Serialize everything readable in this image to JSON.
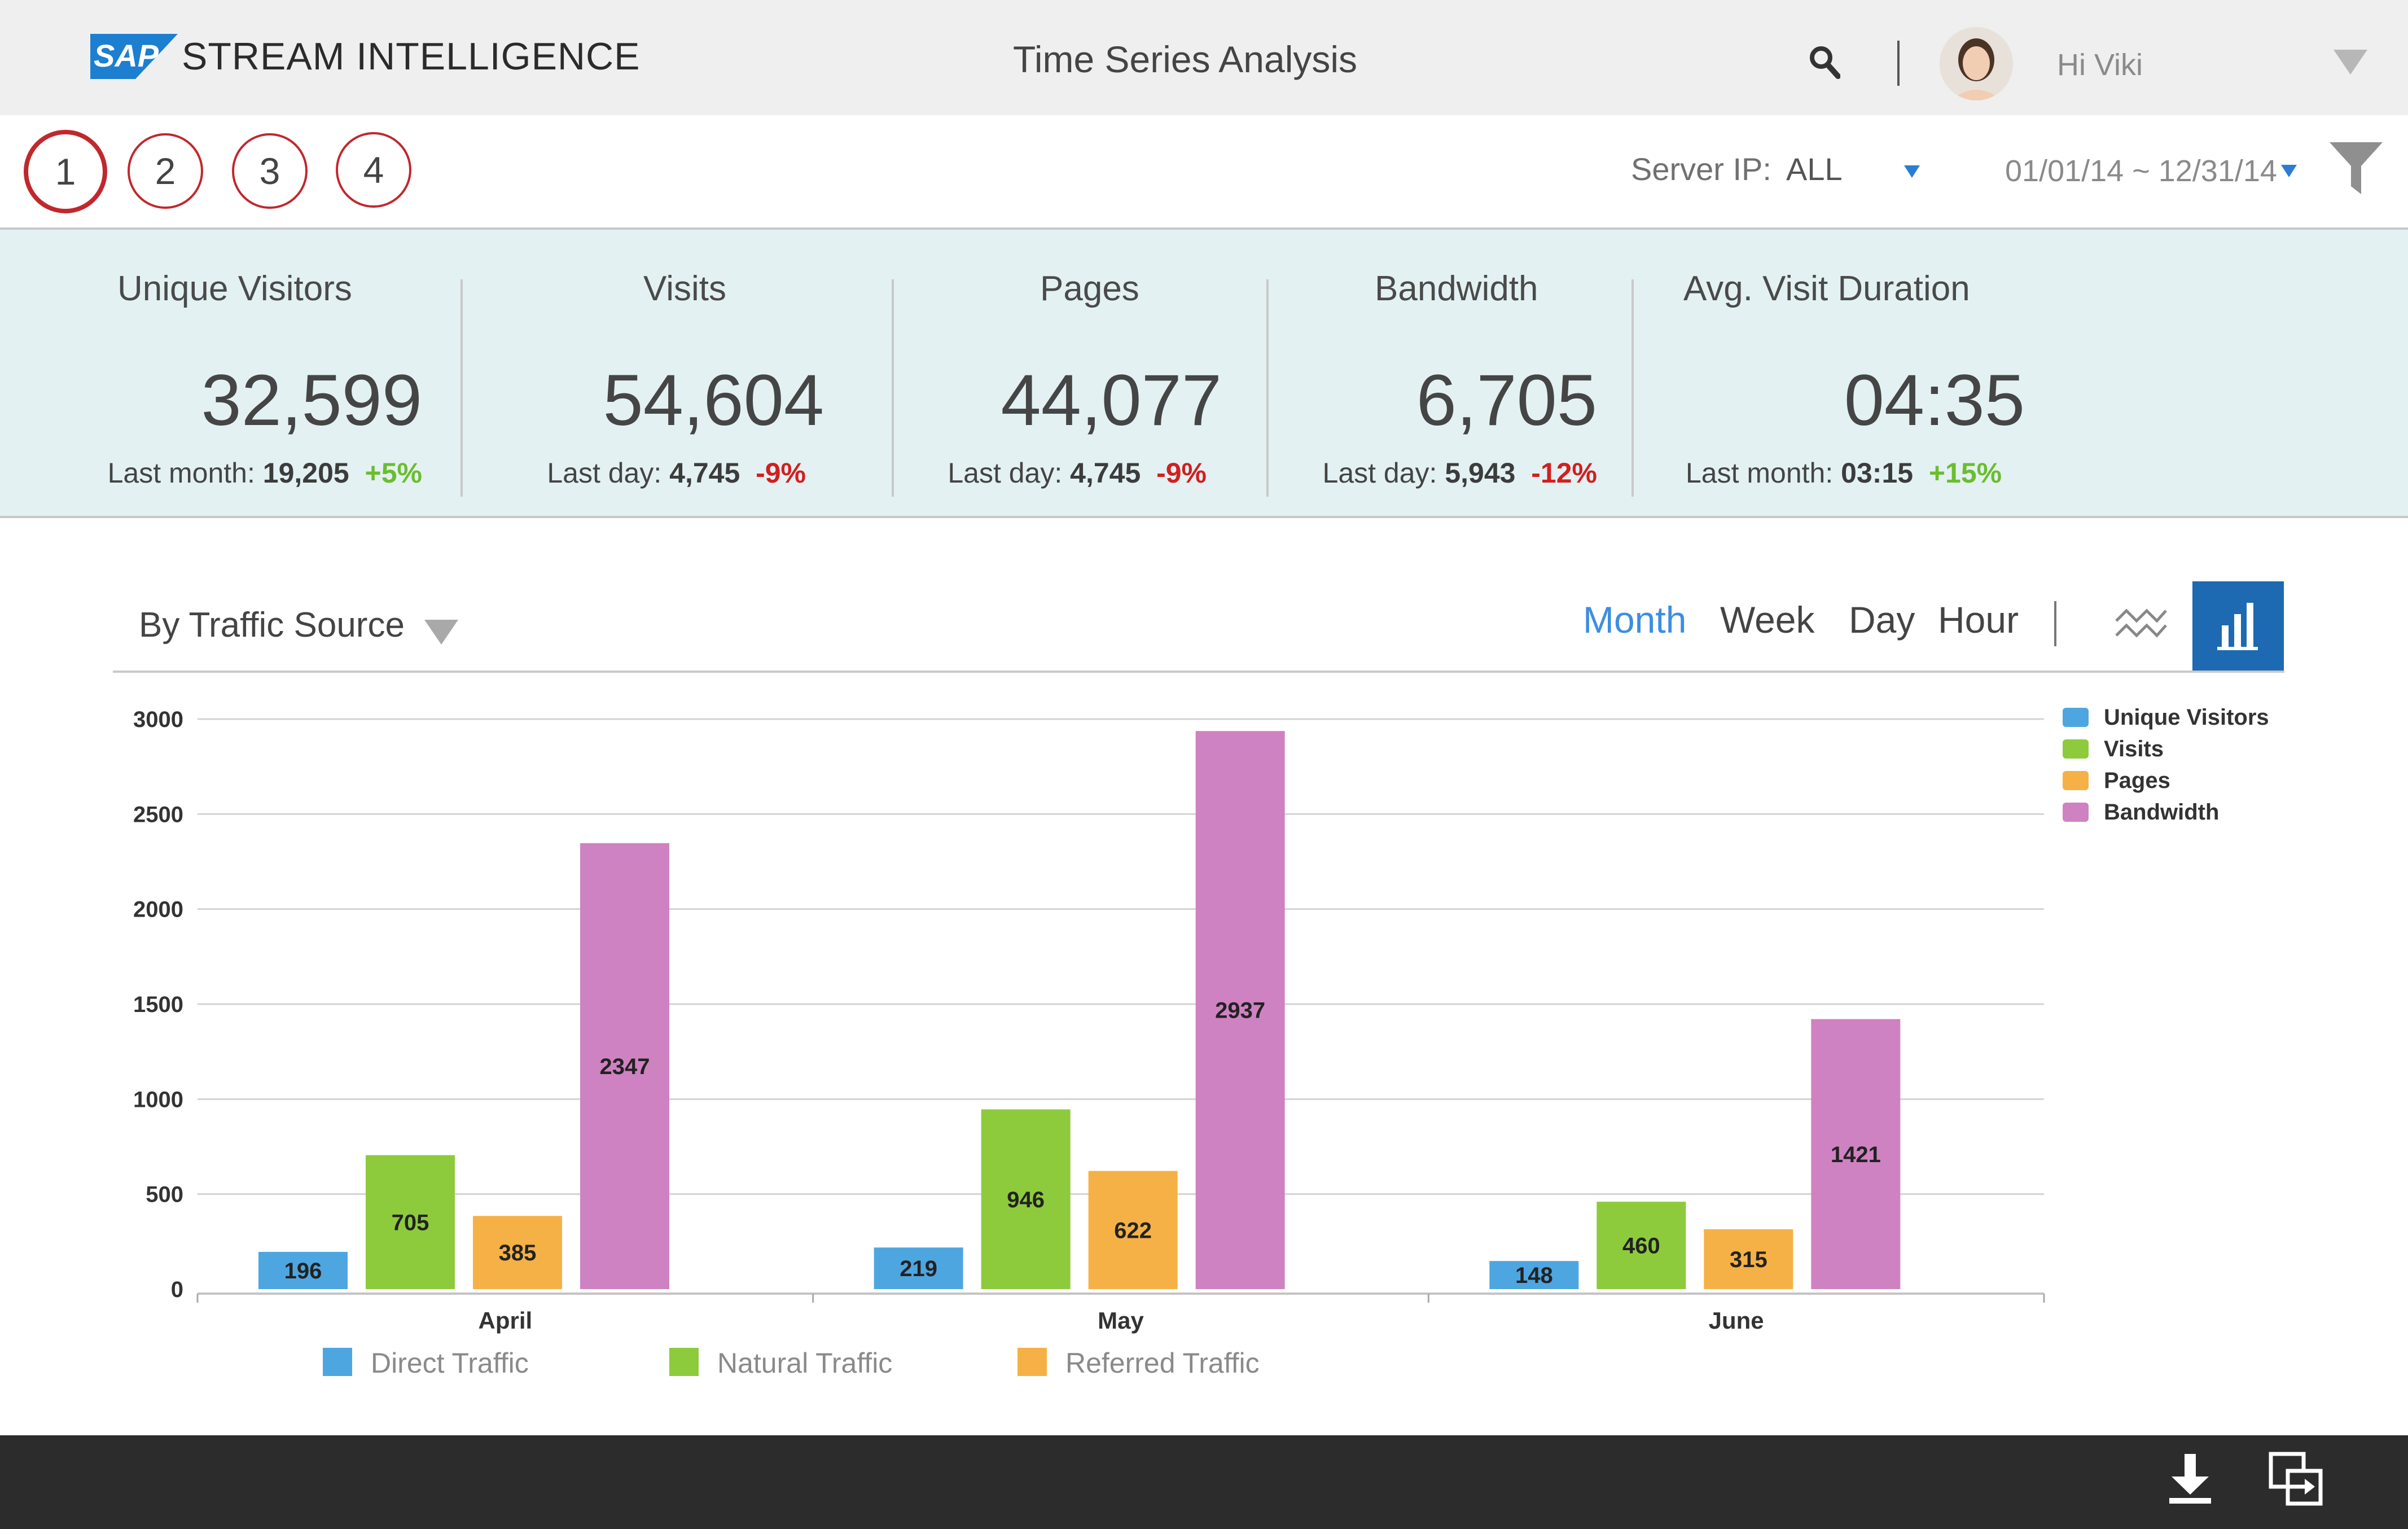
{
  "header": {
    "logo_text": "SAP",
    "brand": "STREAM INTELLIGENCE",
    "title": "Time Series Analysis",
    "greeting": "Hi Viki"
  },
  "steps": [
    "1",
    "2",
    "3",
    "4"
  ],
  "filters": {
    "server_label": "Server IP:",
    "server_value": "ALL",
    "date_range": "01/01/14 ~ 12/31/14"
  },
  "kpis": [
    {
      "title": "Unique Visitors",
      "value": "32,599",
      "sub_label": "Last month:",
      "sub_value": "19,205",
      "delta": "+5%",
      "trend": "up"
    },
    {
      "title": "Visits",
      "value": "54,604",
      "sub_label": "Last day:",
      "sub_value": "4,745",
      "delta": "-9%",
      "trend": "down"
    },
    {
      "title": "Pages",
      "value": "44,077",
      "sub_label": "Last day:",
      "sub_value": "4,745",
      "delta": "-9%",
      "trend": "down"
    },
    {
      "title": "Bandwidth",
      "value": "6,705",
      "sub_label": "Last day:",
      "sub_value": "5,943",
      "delta": "-12%",
      "trend": "down"
    },
    {
      "title": "Avg. Visit Duration",
      "value": "04:35",
      "sub_label": "Last month:",
      "sub_value": "03:15",
      "delta": "+15%",
      "trend": "up"
    }
  ],
  "chart_controls": {
    "source_select": "By Traffic Source",
    "periods": [
      "Month",
      "Week",
      "Day",
      "Hour"
    ],
    "active_period": "Month",
    "active_view": "bar"
  },
  "chart_data": {
    "type": "bar",
    "categories": [
      "April",
      "May",
      "June"
    ],
    "series": [
      {
        "name": "Unique Visitors",
        "color": "#4ea6e0",
        "values": [
          196,
          219,
          148
        ]
      },
      {
        "name": "Visits",
        "color": "#8dcb3c",
        "values": [
          705,
          946,
          460
        ]
      },
      {
        "name": "Pages",
        "color": "#f5b145",
        "values": [
          385,
          622,
          315
        ]
      },
      {
        "name": "Bandwidth",
        "color": "#cf82c1",
        "values": [
          2347,
          2937,
          1421
        ]
      }
    ],
    "ylim": [
      0,
      3000
    ],
    "yticks": [
      0,
      500,
      1000,
      1500,
      2000,
      2500,
      3000
    ],
    "grid": true,
    "legend_position": "top-right",
    "bottom_legend": [
      {
        "name": "Direct Traffic",
        "color": "#4ea6e0"
      },
      {
        "name": "Natural Traffic",
        "color": "#8dcb3c"
      },
      {
        "name": "Referred Traffic",
        "color": "#f5b145"
      }
    ]
  }
}
